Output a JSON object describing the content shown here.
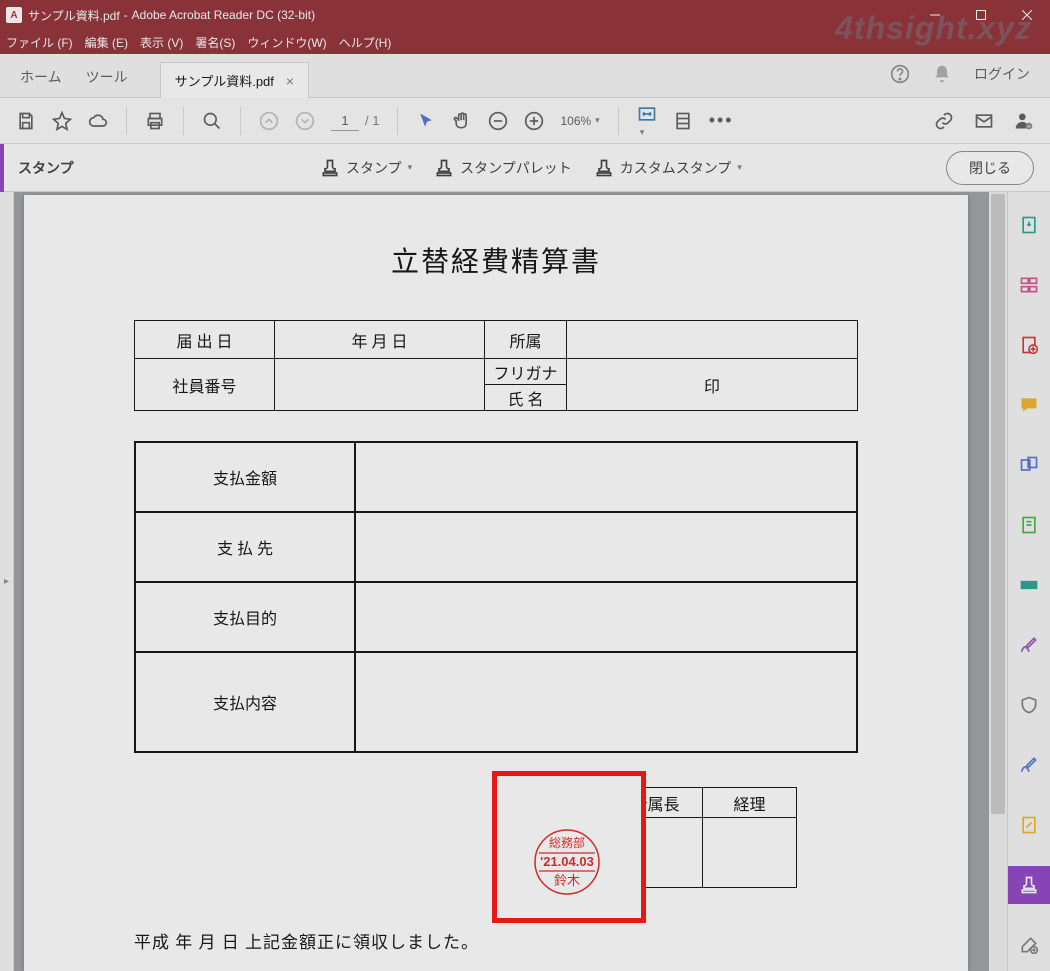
{
  "titlebar": {
    "file": "サンプル資料.pdf",
    "app": "Adobe Acrobat Reader DC (32-bit)"
  },
  "watermark": "4thsight.xyz",
  "menu": {
    "file": "ファイル (F)",
    "edit": "編集 (E)",
    "view": "表示 (V)",
    "sign": "署名(S)",
    "window": "ウィンドウ(W)",
    "help": "ヘルプ(H)"
  },
  "tabs": {
    "home": "ホーム",
    "tools": "ツール",
    "doc": "サンプル資料.pdf",
    "login": "ログイン"
  },
  "toolbar": {
    "page_current": "1",
    "page_total": "/ 1",
    "zoom": "106%"
  },
  "stampbar": {
    "title": "スタンプ",
    "stamp": "スタンプ",
    "palette": "スタンプパレット",
    "custom": "カスタムスタンプ",
    "close": "閉じる"
  },
  "doc": {
    "title": "立替経費精算書",
    "row1": {
      "c1": "届  出  日",
      "c2": "年    月    日",
      "c3": "所属"
    },
    "row2": {
      "c1": "社員番号",
      "c2a": "フリガナ",
      "c2b": "氏  名",
      "c3": "印"
    },
    "t2": {
      "r1": "支払金額",
      "r2": "支 払 先",
      "r3": "支払目的",
      "r4": "支払内容"
    },
    "t3": {
      "h2": "所属長",
      "h3": "経理"
    },
    "hanko": {
      "dept": "総務部",
      "date": "'21.04.03",
      "name": "鈴木"
    },
    "bottom": "平成      年      月      日   上記金額正に領収しました。"
  }
}
